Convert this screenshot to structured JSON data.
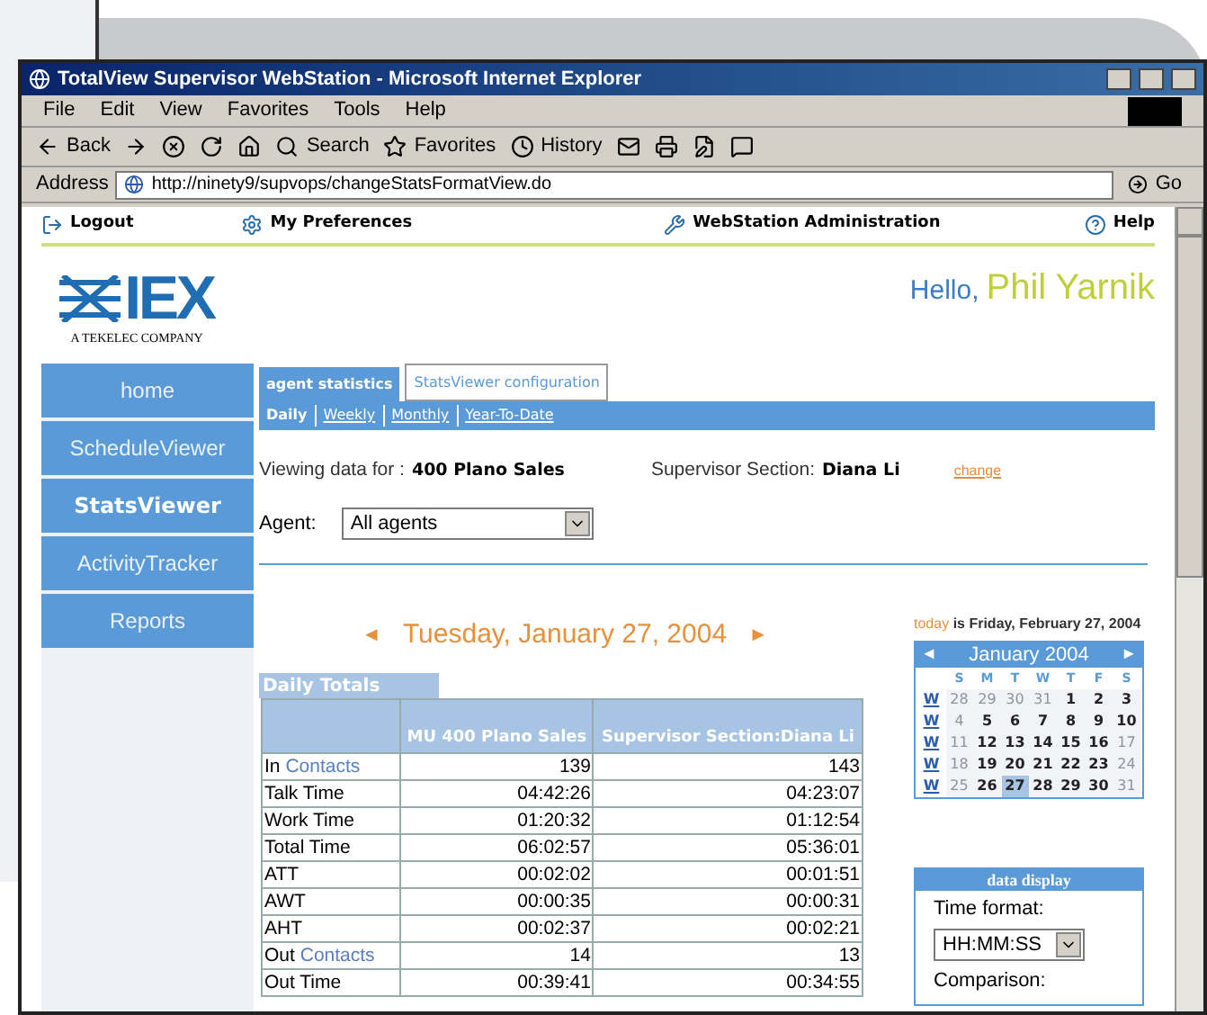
{
  "window": {
    "title": "TotalView Supervisor WebStation - Microsoft Internet Explorer"
  },
  "menu": [
    "File",
    "Edit",
    "View",
    "Favorites",
    "Tools",
    "Help"
  ],
  "toolbar": [
    {
      "kind": "back",
      "label": "Back"
    },
    {
      "kind": "forward"
    },
    {
      "kind": "stop"
    },
    {
      "kind": "refresh"
    },
    {
      "kind": "home"
    },
    {
      "kind": "search",
      "label": "Search"
    },
    {
      "kind": "favorites",
      "label": "Favorites"
    },
    {
      "kind": "history",
      "label": "History"
    },
    {
      "kind": "mail"
    },
    {
      "kind": "print"
    },
    {
      "kind": "edit"
    },
    {
      "kind": "discuss"
    }
  ],
  "address": {
    "label": "Address",
    "value": "http://ninety9/supvops/changeStatsFormatView.do",
    "go": "Go"
  },
  "top_links": [
    {
      "kind": "logout",
      "label": "Logout"
    },
    {
      "kind": "prefs",
      "label": "My Preferences"
    },
    {
      "kind": "admin",
      "label": "WebStation Administration"
    },
    {
      "kind": "help",
      "label": "Help"
    }
  ],
  "logo": {
    "name": "IEX",
    "tagline": "A TEKELEC COMPANY"
  },
  "greeting": {
    "hello": "Hello,",
    "name": "Phil Yarnik"
  },
  "nav": [
    {
      "label": "home",
      "selected": false
    },
    {
      "label": "ScheduleViewer",
      "selected": false
    },
    {
      "label": "StatsViewer",
      "selected": true
    },
    {
      "label": "ActivityTracker",
      "selected": false
    },
    {
      "label": "Reports",
      "selected": false
    }
  ],
  "tabs": [
    {
      "label": "agent statistics",
      "selected": true
    },
    {
      "label": "StatsViewer configuration",
      "selected": false
    }
  ],
  "periods": [
    {
      "label": "Daily",
      "selected": true
    },
    {
      "label": "Weekly",
      "selected": false
    },
    {
      "label": "Monthly",
      "selected": false
    },
    {
      "label": "Year-To-Date",
      "selected": false
    }
  ],
  "viewing": {
    "label": "Viewing data for :",
    "value": "400 Plano Sales",
    "section_label": "Supervisor Section:",
    "section_value": "Diana Li",
    "change": "change"
  },
  "agent": {
    "label": "Agent:",
    "value": "All agents"
  },
  "date": {
    "text": "Tuesday, January 27, 2004",
    "prev": "◄",
    "next": "►"
  },
  "table": {
    "title": "Daily Totals",
    "columns": [
      "MU 400 Plano Sales",
      "Supervisor Section:Diana Li"
    ],
    "rows": [
      {
        "label": "In",
        "link": "Contacts",
        "values": [
          "139",
          "143"
        ]
      },
      {
        "label": "Talk Time",
        "values": [
          "04:42:26",
          "04:23:07"
        ]
      },
      {
        "label": "Work Time",
        "values": [
          "01:20:32",
          "01:12:54"
        ]
      },
      {
        "label": "Total Time",
        "values": [
          "06:02:57",
          "05:36:01"
        ]
      },
      {
        "label": "ATT",
        "values": [
          "00:02:02",
          "00:01:51"
        ]
      },
      {
        "label": "AWT",
        "values": [
          "00:00:35",
          "00:00:31"
        ]
      },
      {
        "label": "AHT",
        "values": [
          "00:02:37",
          "00:02:21"
        ]
      },
      {
        "label": "Out",
        "link": "Contacts",
        "values": [
          "14",
          "13"
        ]
      },
      {
        "label": "Out Time",
        "values": [
          "00:39:41",
          "00:34:55"
        ]
      }
    ]
  },
  "today": {
    "link": "today",
    "text": "is Friday, February 27, 2004"
  },
  "calendar": {
    "title": "January 2004",
    "prev": "◄",
    "next": "►",
    "weekdays": [
      "S",
      "M",
      "T",
      "W",
      "T",
      "F",
      "S"
    ],
    "weeks": [
      {
        "link": "W",
        "days": [
          {
            "d": "28",
            "muted": true,
            "selected": false
          },
          {
            "d": "29",
            "muted": true,
            "selected": false
          },
          {
            "d": "30",
            "muted": true,
            "selected": false
          },
          {
            "d": "31",
            "muted": true,
            "selected": false
          },
          {
            "d": "1",
            "muted": false,
            "selected": false
          },
          {
            "d": "2",
            "muted": false,
            "selected": false
          },
          {
            "d": "3",
            "muted": false,
            "selected": false
          }
        ]
      },
      {
        "link": "W",
        "days": [
          {
            "d": "4",
            "muted": true,
            "selected": false
          },
          {
            "d": "5",
            "muted": false,
            "selected": false
          },
          {
            "d": "6",
            "muted": false,
            "selected": false
          },
          {
            "d": "7",
            "muted": false,
            "selected": false
          },
          {
            "d": "8",
            "muted": false,
            "selected": false
          },
          {
            "d": "9",
            "muted": false,
            "selected": false
          },
          {
            "d": "10",
            "muted": false,
            "selected": false
          }
        ]
      },
      {
        "link": "W",
        "days": [
          {
            "d": "11",
            "muted": true,
            "selected": false
          },
          {
            "d": "12",
            "muted": false,
            "selected": false
          },
          {
            "d": "13",
            "muted": false,
            "selected": false
          },
          {
            "d": "14",
            "muted": false,
            "selected": false
          },
          {
            "d": "15",
            "muted": false,
            "selected": false
          },
          {
            "d": "16",
            "muted": false,
            "selected": false
          },
          {
            "d": "17",
            "muted": true,
            "selected": false
          }
        ]
      },
      {
        "link": "W",
        "days": [
          {
            "d": "18",
            "muted": true,
            "selected": false
          },
          {
            "d": "19",
            "muted": false,
            "selected": false
          },
          {
            "d": "20",
            "muted": false,
            "selected": false
          },
          {
            "d": "21",
            "muted": false,
            "selected": false
          },
          {
            "d": "22",
            "muted": false,
            "selected": false
          },
          {
            "d": "23",
            "muted": false,
            "selected": false
          },
          {
            "d": "24",
            "muted": true,
            "selected": false
          }
        ]
      },
      {
        "link": "W",
        "days": [
          {
            "d": "25",
            "muted": true,
            "selected": false
          },
          {
            "d": "26",
            "muted": false,
            "selected": false
          },
          {
            "d": "27",
            "muted": false,
            "selected": true
          },
          {
            "d": "28",
            "muted": false,
            "selected": false
          },
          {
            "d": "29",
            "muted": false,
            "selected": false
          },
          {
            "d": "30",
            "muted": false,
            "selected": false
          },
          {
            "d": "31",
            "muted": true,
            "selected": false
          }
        ]
      }
    ]
  },
  "data_display": {
    "title": "data display",
    "time_label": "Time format:",
    "time_value": "HH:MM:SS",
    "comparison_label": "Comparison:"
  }
}
